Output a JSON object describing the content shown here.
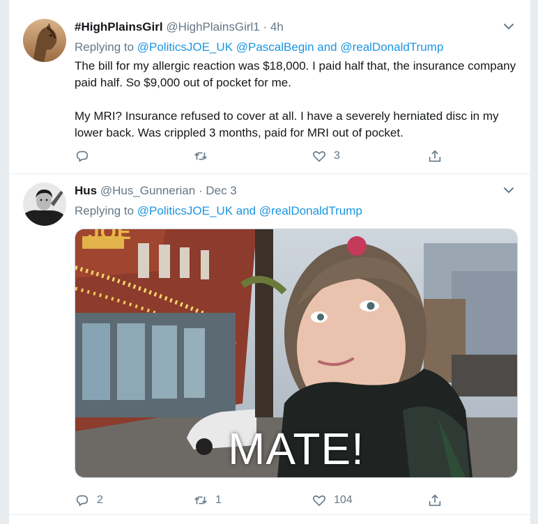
{
  "tweets": [
    {
      "name": "#HighPlainsGirl",
      "handle": "@HighPlainsGirl1",
      "separator": "·",
      "time": "4h",
      "replying_prefix": "Replying to",
      "replying_to": "@PoliticsJOE_UK @PascalBegin and @realDonaldTrump",
      "paragraphs": [
        "The bill for my allergic reaction was $18,000.  I paid half that, the insurance company paid half.  So $9,000 out of pocket for me.",
        "My MRI?  Insurance refused to cover at all.  I have a severely herniated disc in my lower back.  Was crippled 3 months, paid for MRI out of pocket."
      ],
      "actions": {
        "reply_count": "",
        "retweet_count": "",
        "like_count": "3"
      }
    },
    {
      "name": "Hus",
      "handle": "@Hus_Gunnerian",
      "separator": "·",
      "time": "Dec 3",
      "replying_prefix": "Replying to",
      "replying_to": "@PoliticsJOE_UK and @realDonaldTrump",
      "media_caption": "MATE!",
      "media_sign_text": "JOE",
      "actions": {
        "reply_count": "2",
        "retweet_count": "1",
        "like_count": "104"
      }
    }
  ],
  "colors": {
    "link": "#1b95e0",
    "secondary_text": "#657786",
    "border": "#e6ecf0"
  },
  "icons": [
    "reply-icon",
    "retweet-icon",
    "like-icon",
    "share-icon",
    "chevron-down-icon"
  ]
}
